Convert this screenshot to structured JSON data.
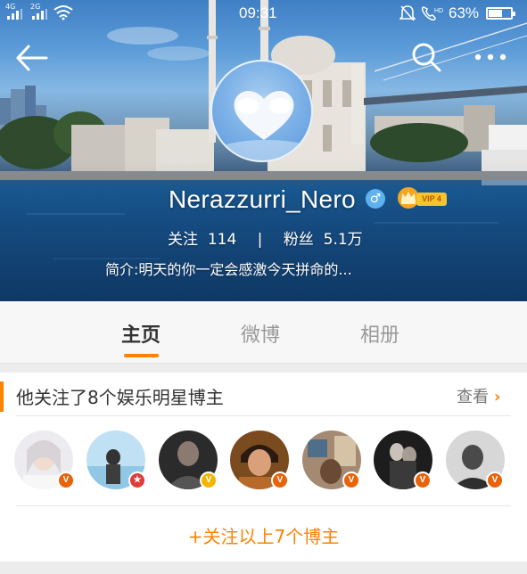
{
  "status_bar": {
    "signal_1": "4G",
    "signal_2": "2G",
    "time": "09:31",
    "battery": "63%",
    "battery_level": 0.63,
    "icons": [
      "wifi-icon",
      "alarm-off-icon",
      "hd-call-icon",
      "battery-icon"
    ]
  },
  "nav": {
    "back_icon": "back-arrow-icon",
    "search_icon": "search-icon",
    "more_icon": "more-icon"
  },
  "profile": {
    "username": "Nerazzurri_Nero",
    "gender_symbol": "♂",
    "vip_label": "VIP 4",
    "following_label": "关注",
    "following_count": "114",
    "separator": "|",
    "followers_label": "粉丝",
    "followers_count": "5.1万",
    "intro": "简介:明天的你一定会感激今天拼命的..."
  },
  "tabs": [
    {
      "label": "主页",
      "active": true
    },
    {
      "label": "微博",
      "active": false
    },
    {
      "label": "相册",
      "active": false
    }
  ],
  "recommend": {
    "title": "他关注了8个娱乐明星博主",
    "see_more": "查看",
    "chevron": "›",
    "follow_all": "+关注以上7个博主",
    "avatars": [
      {
        "name": "star-avatar-1",
        "badge": "V",
        "badge_color": "#e8630a"
      },
      {
        "name": "star-avatar-2",
        "badge": "★",
        "badge_color": "#e03a3a"
      },
      {
        "name": "star-avatar-3",
        "badge": "V",
        "badge_color": "#f5b400"
      },
      {
        "name": "star-avatar-4",
        "badge": "V",
        "badge_color": "#e8630a"
      },
      {
        "name": "star-avatar-5",
        "badge": "V",
        "badge_color": "#e8630a"
      },
      {
        "name": "star-avatar-6",
        "badge": "V",
        "badge_color": "#e8630a"
      },
      {
        "name": "star-avatar-7",
        "badge": "V",
        "badge_color": "#e8630a"
      }
    ]
  },
  "colors": {
    "accent": "#ff8200",
    "tab_active": "#333333",
    "tab_inactive": "#9a9a9a"
  }
}
